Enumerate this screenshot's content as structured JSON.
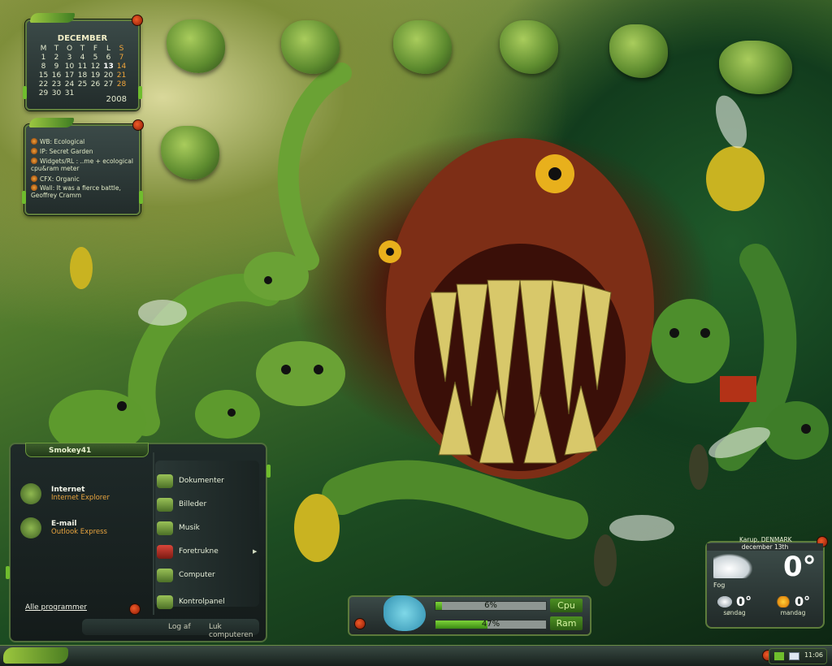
{
  "calendar": {
    "month": "DECEMBER",
    "weekdays": [
      "M",
      "T",
      "O",
      "T",
      "F",
      "L",
      "S"
    ],
    "weeks": [
      [
        "1",
        "2",
        "3",
        "4",
        "5",
        "6",
        "7"
      ],
      [
        "8",
        "9",
        "10",
        "11",
        "12",
        "13",
        "14"
      ],
      [
        "15",
        "16",
        "17",
        "18",
        "19",
        "20",
        "21"
      ],
      [
        "22",
        "23",
        "24",
        "25",
        "26",
        "27",
        "28"
      ],
      [
        "29",
        "30",
        "31",
        "",
        "",
        "",
        ""
      ]
    ],
    "year": "2008"
  },
  "credits": [
    "WB: Ecological",
    "IP: Secret Garden",
    "Widgets/RL : ..me + ecological cpu&ram meter",
    "CFX: Organic",
    "Wall: It was a fierce battle, Geoffrey Cramm"
  ],
  "start_menu": {
    "username": "Smokey41",
    "pinned": [
      {
        "title": "Internet",
        "subtitle": "Internet Explorer"
      },
      {
        "title": "E-mail",
        "subtitle": "Outlook Express"
      }
    ],
    "places": [
      "Dokumenter",
      "Billeder",
      "Musik",
      "Foretrukne",
      "Computer",
      "Kontrolpanel"
    ],
    "all_programs": "Alle programmer",
    "logoff": "Log af",
    "shutdown": "Luk computeren"
  },
  "meters": {
    "cpu_label": "Cpu",
    "ram_label": "Ram",
    "cpu_value": "6%",
    "ram_value": "47%",
    "cpu_fraction": 0.06,
    "ram_fraction": 0.47
  },
  "weather": {
    "location": "Karup, DENMARK",
    "date": "december 13th",
    "current_temp": "0°",
    "condition": "Fog",
    "forecast": [
      {
        "temp": "0°",
        "day": "søndag",
        "icon": "snow-cloud-icon"
      },
      {
        "temp": "0°",
        "day": "mandag",
        "icon": "sun-icon"
      }
    ]
  },
  "taskbar": {
    "clock": "11:06"
  },
  "colors": {
    "accent_green": "#6fbd2d",
    "highlight_orange": "#e9a53f",
    "panel_dark": "#1f2a29"
  }
}
